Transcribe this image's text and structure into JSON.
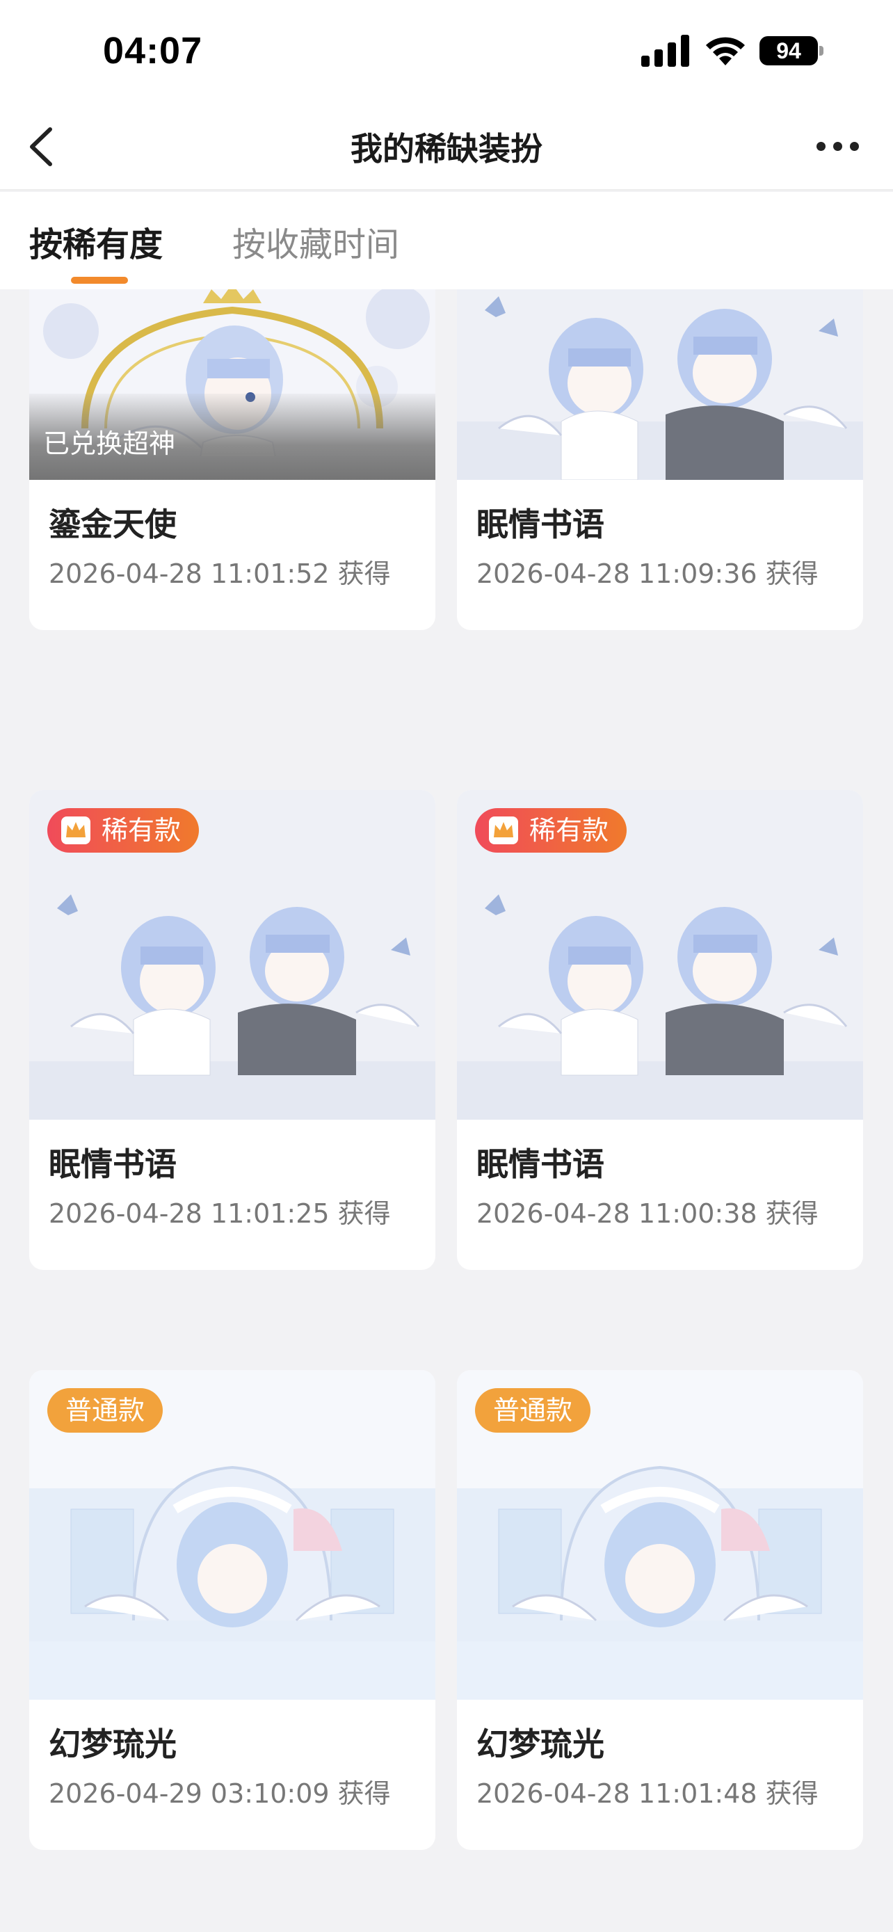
{
  "status_bar": {
    "time": "04:07",
    "battery": "94"
  },
  "nav": {
    "title": "我的稀缺装扮"
  },
  "tabs": [
    {
      "label": "按稀有度",
      "active": true
    },
    {
      "label": "按收藏时间",
      "active": false
    }
  ],
  "cards": [
    {
      "name": "鎏金天使",
      "date": "2026-04-28 11:01:52 获得",
      "overlay": "已兑换超神",
      "theme": "gold-angel"
    },
    {
      "name": "眠情书语",
      "date": "2026-04-28 11:09:36 获得",
      "theme": "sleepy-duo"
    },
    {
      "name": "眠情书语",
      "date": "2026-04-28 11:01:25 获得",
      "badge": "稀有款",
      "badge_type": "rare",
      "theme": "sleepy-duo"
    },
    {
      "name": "眠情书语",
      "date": "2026-04-28 11:00:38 获得",
      "badge": "稀有款",
      "badge_type": "rare",
      "theme": "sleepy-duo"
    },
    {
      "name": "幻梦琉光",
      "date": "2026-04-29 03:10:09 获得",
      "badge": "普通款",
      "badge_type": "normal",
      "theme": "dream-light"
    },
    {
      "name": "幻梦琉光",
      "date": "2026-04-28 11:01:48 获得",
      "badge": "普通款",
      "badge_type": "normal",
      "theme": "dream-light"
    }
  ],
  "colors": {
    "accent": "#f28a2c",
    "rare_badge": "#f04b5a",
    "normal_badge": "#f2a23c"
  }
}
